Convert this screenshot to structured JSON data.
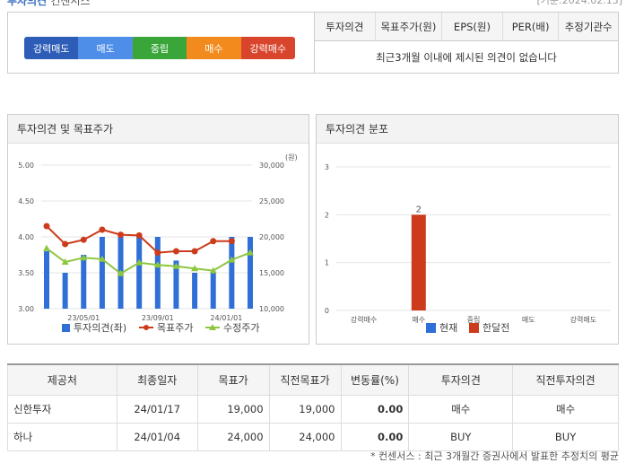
{
  "header": {
    "left_title": "투자의견",
    "left_sub": "컨센서스",
    "right_date": "[기준:2024.02.13]"
  },
  "scale": {
    "items": [
      {
        "label": "강력매도",
        "color": "#2e5db8"
      },
      {
        "label": "매도",
        "color": "#4f8ee8"
      },
      {
        "label": "중립",
        "color": "#3aa63a"
      },
      {
        "label": "매수",
        "color": "#f28a1d"
      },
      {
        "label": "강력매수",
        "color": "#d9442c"
      }
    ]
  },
  "summary": {
    "headers": [
      "투자의견",
      "목표주가(원)",
      "EPS(원)",
      "PER(배)",
      "추정기관수"
    ],
    "message": "최근3개월 이내에 제시된 의견이 없습니다"
  },
  "left_panel": {
    "title": "투자의견 및 목표주가"
  },
  "right_panel": {
    "title": "투자의견 분포"
  },
  "chart_data": [
    {
      "type": "bar+line",
      "title": "",
      "y_left": {
        "ticks": [
          "5.00",
          "4.50",
          "4.00",
          "3.50",
          "3.00"
        ],
        "range": [
          3.0,
          5.0
        ]
      },
      "y_right": {
        "unit": "(원)",
        "ticks": [
          "30,000",
          "25,000",
          "20,000",
          "15,000",
          "10,000"
        ],
        "range": [
          10000,
          30000
        ]
      },
      "x_ticks": [
        "23/05/01",
        "23/09/01",
        "24/01/01"
      ],
      "bars": [
        3.8,
        3.5,
        3.75,
        4.0,
        4.0,
        4.0,
        4.0,
        3.67,
        3.5,
        3.5,
        4.0,
        4.0
      ],
      "target_price": [
        21500,
        19000,
        19600,
        21000,
        20300,
        20200,
        17800,
        18000,
        18000,
        19400,
        19400
      ],
      "adjusted_price": [
        18400,
        16500,
        17100,
        16900,
        14900,
        16400,
        16100,
        15900,
        15600,
        15300,
        16800,
        17800
      ],
      "legend": [
        "투자의견(좌)",
        "목표주가",
        "수정주가"
      ],
      "colors": {
        "bar": "#2f6fd6",
        "target": "#cc3b1b",
        "adjusted": "#8dc63f"
      }
    },
    {
      "type": "bar",
      "title": "",
      "categories": [
        "강력매수",
        "매수",
        "중립",
        "매도",
        "강력매도"
      ],
      "y_ticks": [
        "3",
        "2",
        "1",
        "0"
      ],
      "ylim": [
        0,
        3
      ],
      "series": [
        {
          "name": "현재",
          "values": [
            0,
            0,
            0,
            0,
            0
          ],
          "color": "#2f6fd6"
        },
        {
          "name": "한달전",
          "values": [
            0,
            2,
            0,
            0,
            0
          ],
          "color": "#cc3b1b"
        }
      ],
      "data_labels": [
        "2"
      ]
    }
  ],
  "table": {
    "headers": [
      "제공처",
      "최종일자",
      "목표가",
      "직전목표가",
      "변동률(%)",
      "투자의견",
      "직전투자의견"
    ],
    "rows": [
      [
        "신한투자",
        "24/01/17",
        "19,000",
        "19,000",
        "0.00",
        "매수",
        "매수"
      ],
      [
        "하나",
        "24/01/04",
        "24,000",
        "24,000",
        "0.00",
        "BUY",
        "BUY"
      ]
    ]
  },
  "footnote": "* 컨센서스 : 최근 3개월간 증권사에서 발표한 추정치의 평균"
}
